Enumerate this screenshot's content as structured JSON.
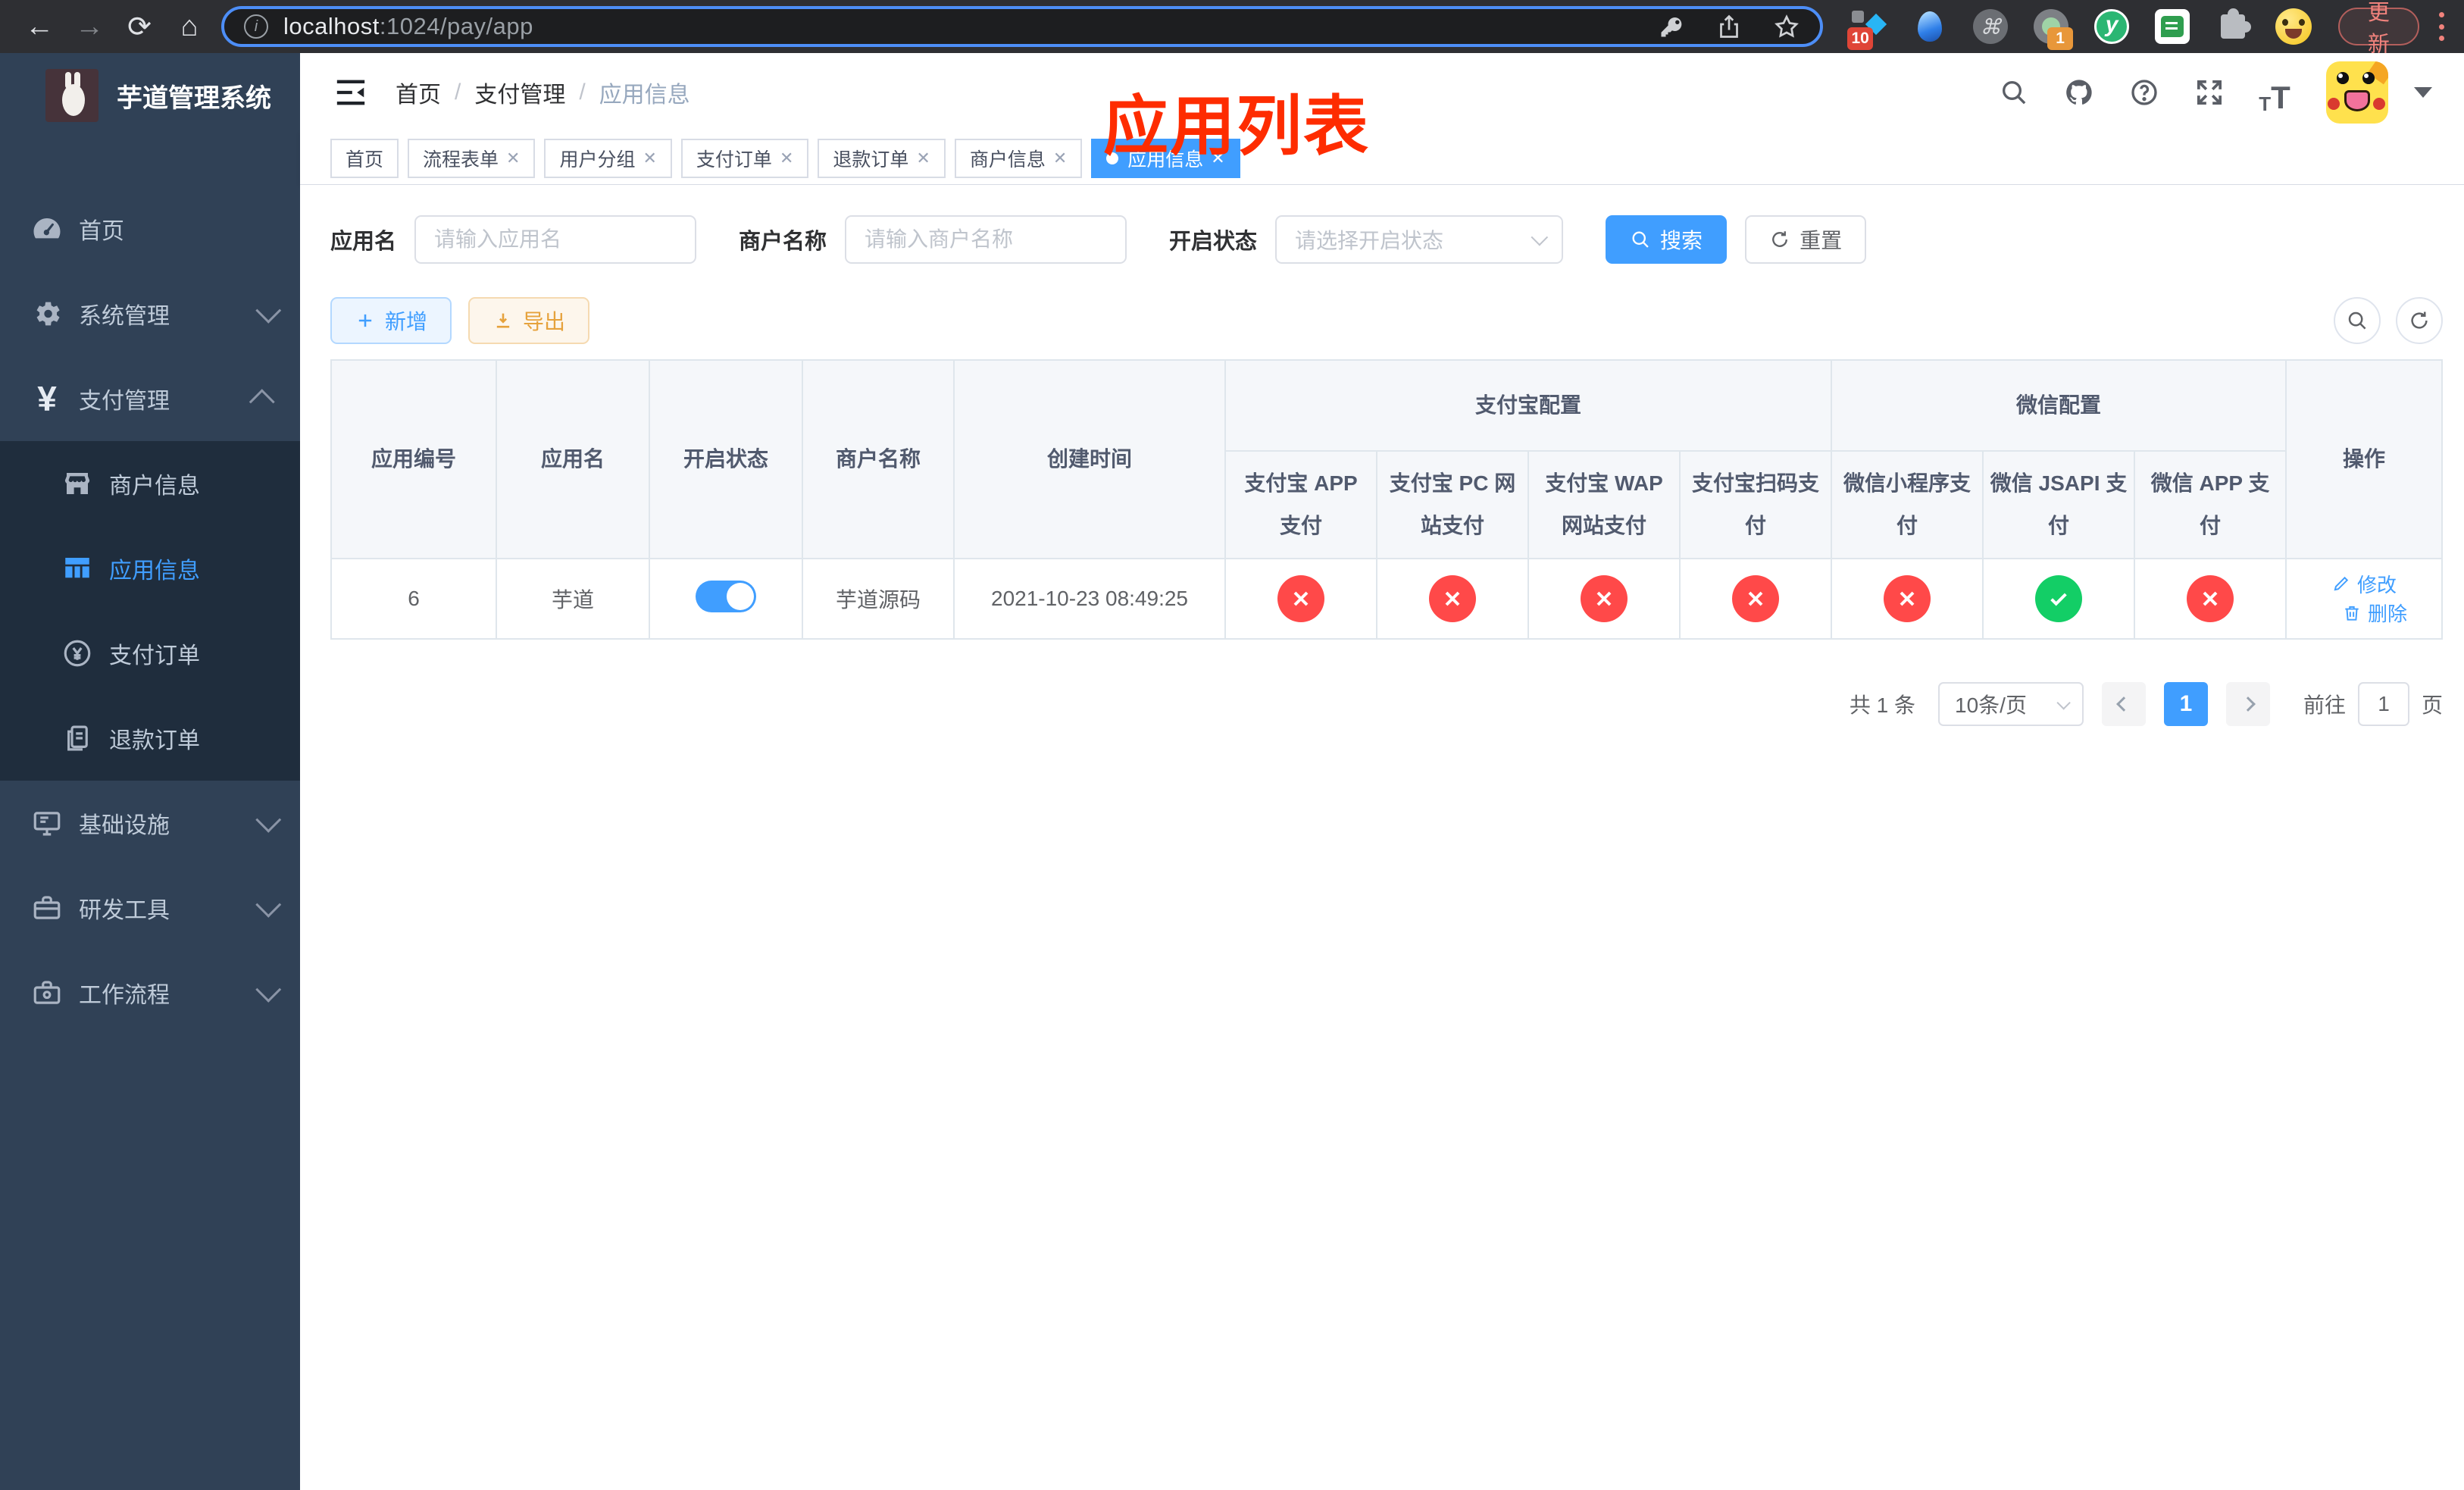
{
  "browser": {
    "url_host": "localhost",
    "url_path": ":1024/pay/app",
    "update_label": "更新",
    "badge_pin": "10",
    "badge_cast": "1"
  },
  "sidebar": {
    "logo_title": "芋道管理系统",
    "home": "首页",
    "system": "系统管理",
    "payment": "支付管理",
    "merchant": "商户信息",
    "app_info": "应用信息",
    "pay_order": "支付订单",
    "refund_order": "退款订单",
    "infra": "基础设施",
    "dev_tools": "研发工具",
    "workflow": "工作流程"
  },
  "header": {
    "breadcrumb_home": "首页",
    "breadcrumb_section": "支付管理",
    "breadcrumb_current": "应用信息",
    "overlay_title": "应用列表"
  },
  "tabs": {
    "items": [
      {
        "label": "首页",
        "closable": false,
        "active": false
      },
      {
        "label": "流程表单",
        "closable": true,
        "active": false
      },
      {
        "label": "用户分组",
        "closable": true,
        "active": false
      },
      {
        "label": "支付订单",
        "closable": true,
        "active": false
      },
      {
        "label": "退款订单",
        "closable": true,
        "active": false
      },
      {
        "label": "商户信息",
        "closable": true,
        "active": false
      },
      {
        "label": "应用信息",
        "closable": true,
        "active": true
      }
    ]
  },
  "filters": {
    "app_name_label": "应用名",
    "app_name_placeholder": "请输入应用名",
    "merchant_label": "商户名称",
    "merchant_placeholder": "请输入商户名称",
    "status_label": "开启状态",
    "status_placeholder": "请选择开启状态",
    "search_label": "搜索",
    "reset_label": "重置"
  },
  "toolbar": {
    "add_label": "新增",
    "export_label": "导出"
  },
  "table": {
    "headers": {
      "app_id": "应用编号",
      "app_name": "应用名",
      "open_status": "开启状态",
      "merchant_name": "商户名称",
      "create_time": "创建时间",
      "alipay_group": "支付宝配置",
      "wechat_group": "微信配置",
      "actions": "操作",
      "alipay_app": "支付宝 APP 支付",
      "alipay_pc": "支付宝 PC 网站支付",
      "alipay_wap": "支付宝 WAP 网站支付",
      "alipay_qr": "支付宝扫码支付",
      "wx_mini": "微信小程序支付",
      "wx_jsapi": "微信 JSAPI 支付",
      "wx_app": "微信 APP 支付"
    },
    "row": {
      "app_id": "6",
      "app_name": "芋道",
      "switch_on": true,
      "merchant_name": "芋道源码",
      "create_time": "2021-10-23 08:49:25",
      "configs": [
        "fail",
        "fail",
        "fail",
        "fail",
        "fail",
        "ok",
        "fail"
      ],
      "edit_label": "修改",
      "delete_label": "删除"
    }
  },
  "pagination": {
    "total_text": "共 1 条",
    "page_size": "10条/页",
    "current_page": "1",
    "goto_label": "前往",
    "goto_value": "1",
    "page_suffix": "页"
  },
  "colors": {
    "accent": "#409eff",
    "status_ok": "#13ce66",
    "status_fail": "#ff4949",
    "warning": "#e6a23c",
    "sidebar_bg": "#304156",
    "overlay_title_red": "#fe2c00"
  }
}
